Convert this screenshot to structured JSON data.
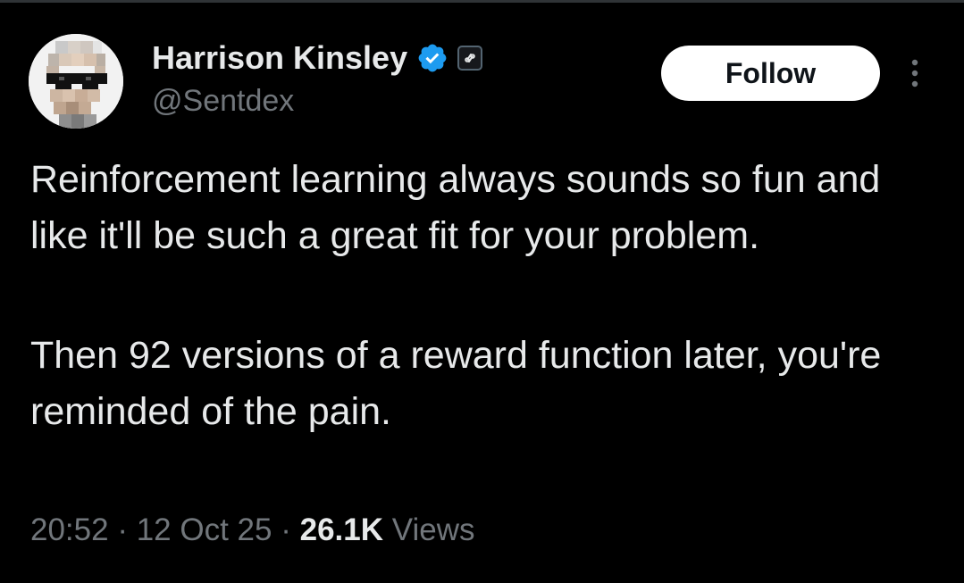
{
  "author": {
    "display_name": "Harrison Kinsley",
    "handle": "@Sentdex",
    "verified_color": "#1d9bf0"
  },
  "actions": {
    "follow_label": "Follow"
  },
  "tweet": {
    "paragraphs": [
      "Reinforcement learning always sounds so fun and like it'll be such a great fit for your problem.",
      "Then 92 versions of a reward function later, you're reminded of the pain."
    ]
  },
  "meta": {
    "time": "20:52",
    "separator": "·",
    "date": "12 Oct 25",
    "views_count": "26.1K",
    "views_label": "Views"
  },
  "icons": {
    "verified": "verified-badge-icon",
    "affiliation": "affiliation-badge-icon",
    "more": "more-options-icon"
  }
}
